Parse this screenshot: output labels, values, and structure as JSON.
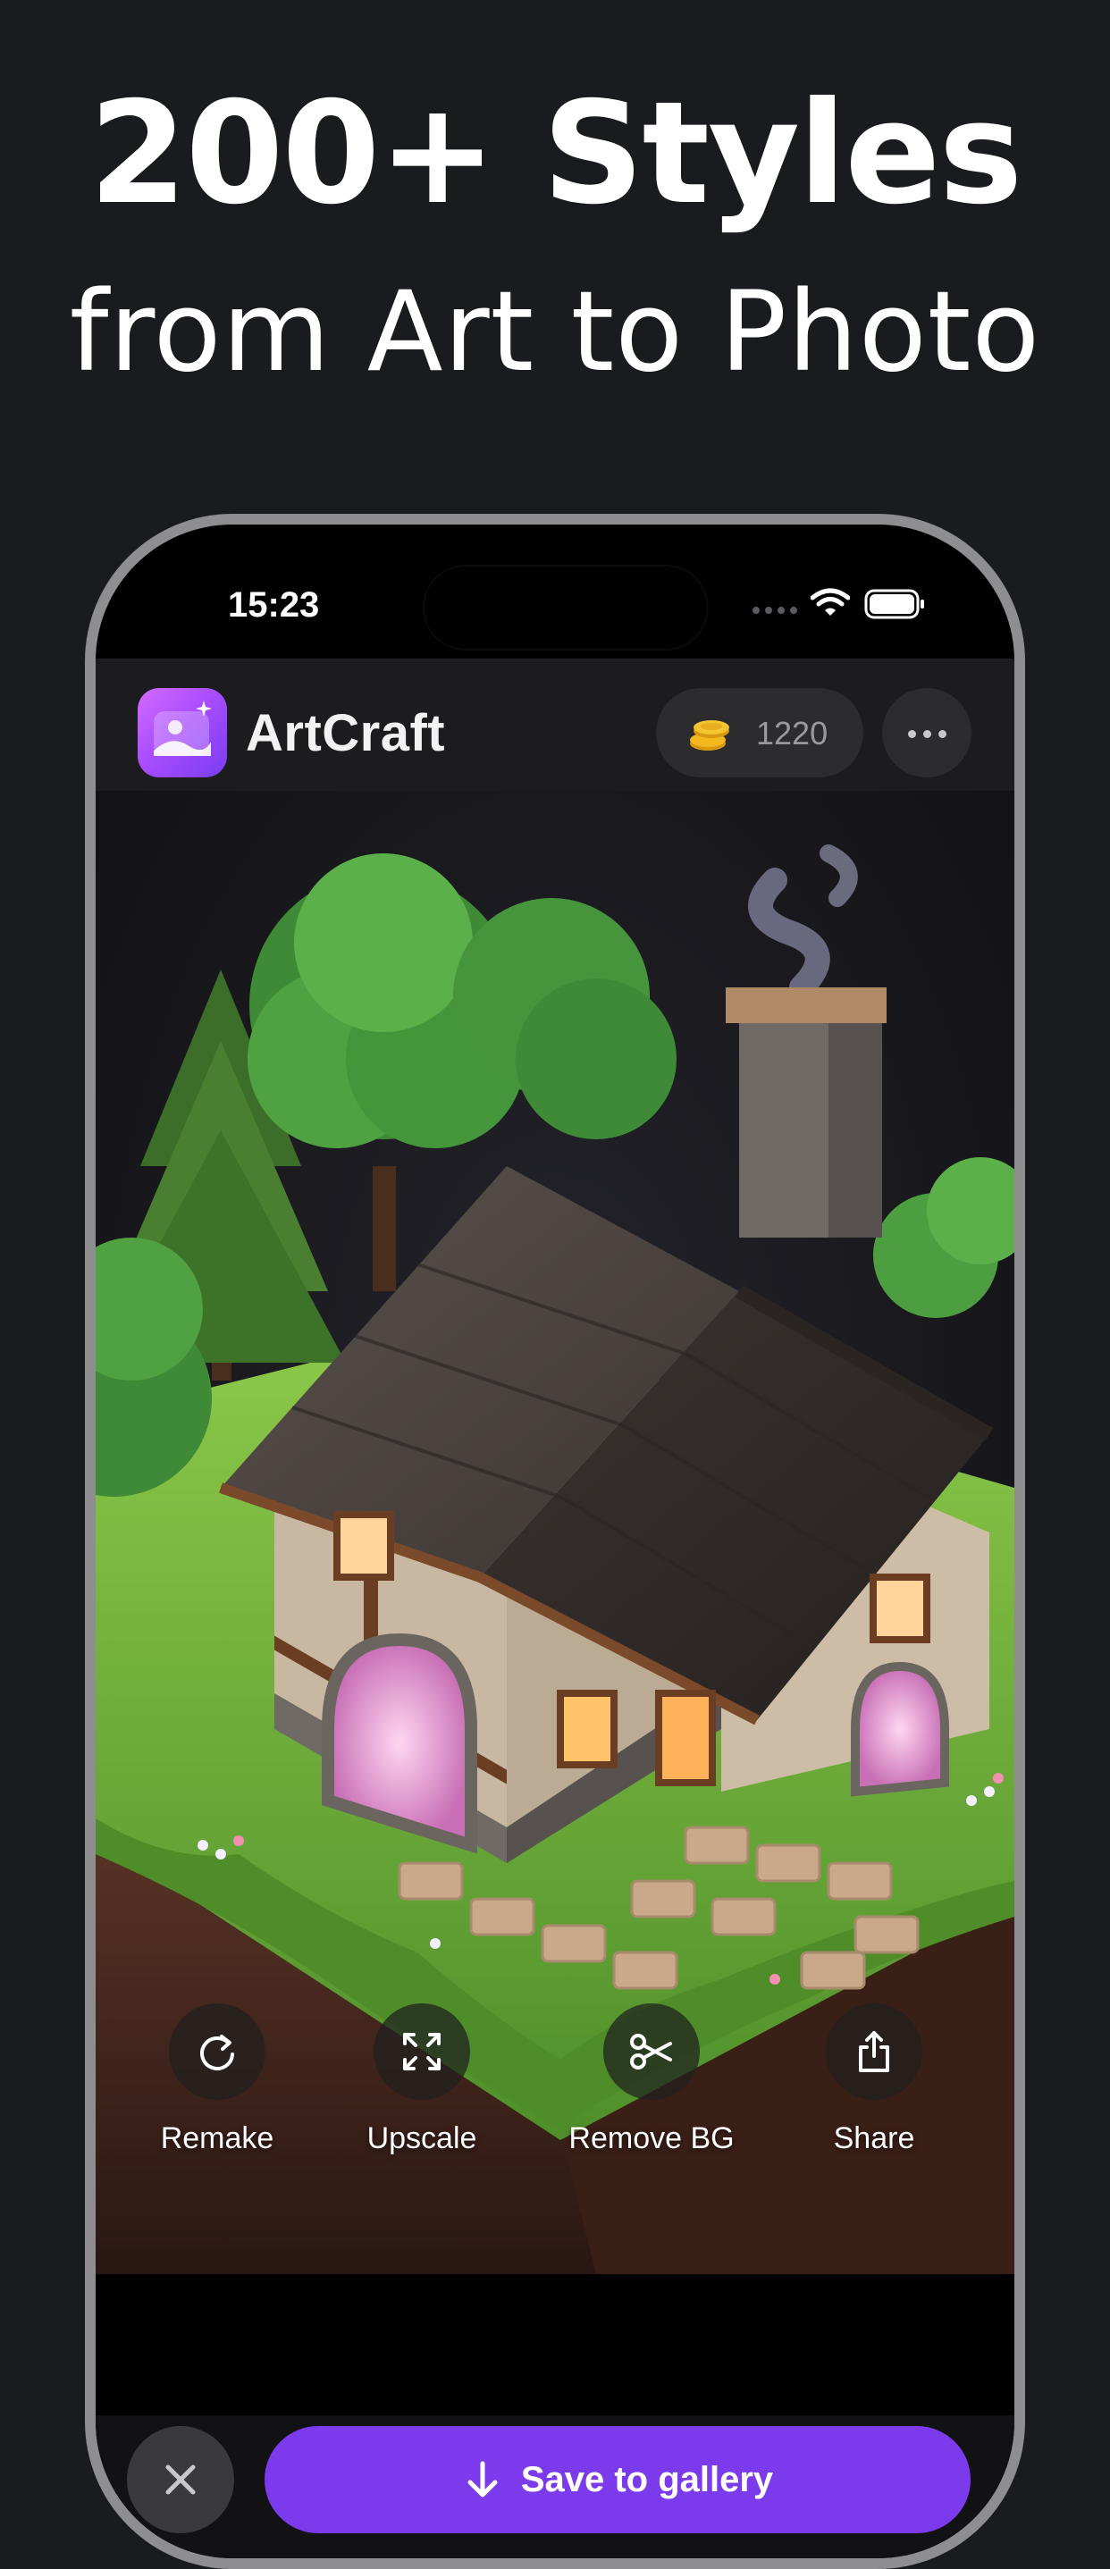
{
  "promo": {
    "headline_line1": "200+ Styles",
    "headline_line2": "from Art to Photo"
  },
  "status_bar": {
    "time": "15:23"
  },
  "header": {
    "app_name": "ArtCraft",
    "coins": "1220"
  },
  "actions": [
    {
      "label": "Remake",
      "icon": "refresh-icon"
    },
    {
      "label": "Upscale",
      "icon": "expand-icon"
    },
    {
      "label": "Remove BG",
      "icon": "scissors-icon"
    },
    {
      "label": "Share",
      "icon": "share-icon"
    }
  ],
  "bottom_bar": {
    "save_label": "Save to gallery",
    "close_icon": "close-icon",
    "download_icon": "download-arrow-icon"
  },
  "colors": {
    "background": "#1a1b1e",
    "accent": "#7c3aed",
    "logo_gradient_start": "#d46bff",
    "logo_gradient_end": "#7a3df0",
    "coin": "#f2b81d"
  }
}
